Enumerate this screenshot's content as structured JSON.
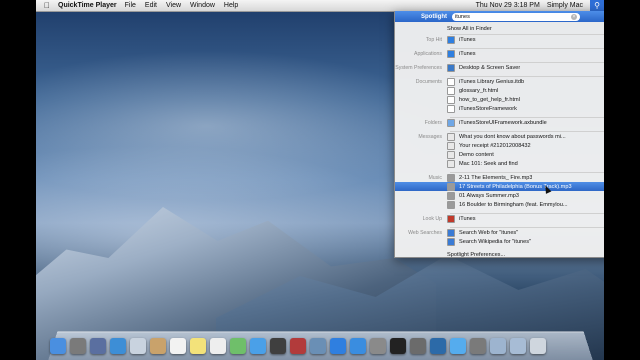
{
  "menubar": {
    "app_name": "QuickTime Player",
    "menus": [
      "File",
      "Edit",
      "View",
      "Window",
      "Help"
    ],
    "clock": "Thu Nov 29  3:18 PM",
    "user": "Simply Mac"
  },
  "spotlight": {
    "label": "Spotlight",
    "query": "itunes",
    "show_all": "Show All in Finder",
    "sections": [
      {
        "category": "Top Hit",
        "items": [
          {
            "label": "iTunes",
            "icon": "itunes-icon",
            "color": "#2f7fe0"
          }
        ]
      },
      {
        "category": "Applications",
        "items": [
          {
            "label": "iTunes",
            "icon": "itunes-icon",
            "color": "#2f7fe0"
          }
        ]
      },
      {
        "category": "System Preferences",
        "items": [
          {
            "label": "Desktop & Screen Saver",
            "icon": "prefs-icon",
            "color": "#3a79c8"
          }
        ]
      },
      {
        "category": "Documents",
        "items": [
          {
            "label": "iTunes Library Genius.itdb",
            "icon": "document-icon",
            "color": "#ffffff"
          },
          {
            "label": "glossary_fr.html",
            "icon": "document-icon",
            "color": "#ffffff"
          },
          {
            "label": "how_to_get_help_fr.html",
            "icon": "document-icon",
            "color": "#ffffff"
          },
          {
            "label": "iTunesStoreFramework",
            "icon": "document-icon",
            "color": "#ffffff"
          }
        ]
      },
      {
        "category": "Folders",
        "items": [
          {
            "label": "iTunesStoreUIFramework.axbundle",
            "icon": "folder-icon",
            "color": "#6fa7e6"
          }
        ]
      },
      {
        "category": "Messages",
        "items": [
          {
            "label": "What you dont know about passwords mi...",
            "icon": "mail-icon",
            "color": "#e8e8e8"
          },
          {
            "label": "Your receipt #212012008432",
            "icon": "mail-icon",
            "color": "#e8e8e8"
          },
          {
            "label": "Demo content",
            "icon": "mail-icon",
            "color": "#e8e8e8"
          },
          {
            "label": "Mac 101: Seek and find",
            "icon": "mail-icon",
            "color": "#e8e8e8"
          }
        ]
      },
      {
        "category": "Music",
        "items": [
          {
            "label": "2-11 The Elements_ Fire.mp3",
            "icon": "music-icon",
            "color": "#9a9a9a"
          },
          {
            "label": "17 Streets of Philadelphia (Bonus Track).mp3",
            "icon": "music-icon",
            "color": "#9a9a9a",
            "selected": true
          },
          {
            "label": "01 Always Summer.mp3",
            "icon": "music-icon",
            "color": "#9a9a9a"
          },
          {
            "label": "16 Boulder to Birmingham (feat. Emmylou...",
            "icon": "music-icon",
            "color": "#9a9a9a"
          }
        ]
      },
      {
        "category": "Look Up",
        "items": [
          {
            "label": "iTunes",
            "icon": "dictionary-icon",
            "color": "#c0392b"
          }
        ]
      },
      {
        "category": "Web Searches",
        "items": [
          {
            "label": "Search Web for \"itunes\"",
            "icon": "web-search-icon",
            "color": "#3a7bd5"
          },
          {
            "label": "Search Wikipedia for \"itunes\"",
            "icon": "web-search-icon",
            "color": "#3a7bd5"
          }
        ]
      }
    ],
    "preferences": "Spotlight Preferences..."
  },
  "dock": {
    "icons": [
      {
        "name": "finder-icon",
        "color": "#4a8fe0"
      },
      {
        "name": "launchpad-icon",
        "color": "#7a7a7a"
      },
      {
        "name": "mission-control-icon",
        "color": "#5a6fa0"
      },
      {
        "name": "safari-icon",
        "color": "#3d8ed6"
      },
      {
        "name": "mail-icon",
        "color": "#c9d3df"
      },
      {
        "name": "contacts-icon",
        "color": "#c9a26b"
      },
      {
        "name": "calendar-icon",
        "color": "#f2f2f2"
      },
      {
        "name": "notes-icon",
        "color": "#f3e27a"
      },
      {
        "name": "reminders-icon",
        "color": "#eeeeee"
      },
      {
        "name": "maps-icon",
        "color": "#6fbf6a"
      },
      {
        "name": "messages-icon",
        "color": "#4aa0e8"
      },
      {
        "name": "facetime-icon",
        "color": "#3f3f3f"
      },
      {
        "name": "photo-booth-icon",
        "color": "#b23b3b"
      },
      {
        "name": "iphoto-icon",
        "color": "#6a8fb5"
      },
      {
        "name": "itunes-icon",
        "color": "#2f7fe0"
      },
      {
        "name": "app-store-icon",
        "color": "#3a8de0"
      },
      {
        "name": "system-preferences-icon",
        "color": "#8a8a8a"
      },
      {
        "name": "terminal-icon",
        "color": "#222222"
      },
      {
        "name": "grab-icon",
        "color": "#6b6b6b"
      },
      {
        "name": "quicktime-icon",
        "color": "#2c6aa8"
      },
      {
        "name": "twitter-icon",
        "color": "#55acee"
      },
      {
        "name": "app-icon",
        "color": "#7a7a7a"
      },
      {
        "name": "downloads-stack-icon",
        "color": "#9db4cf"
      },
      {
        "name": "documents-stack-icon",
        "color": "#a7bcd5"
      },
      {
        "name": "trash-icon",
        "color": "#cfd6de"
      }
    ]
  }
}
